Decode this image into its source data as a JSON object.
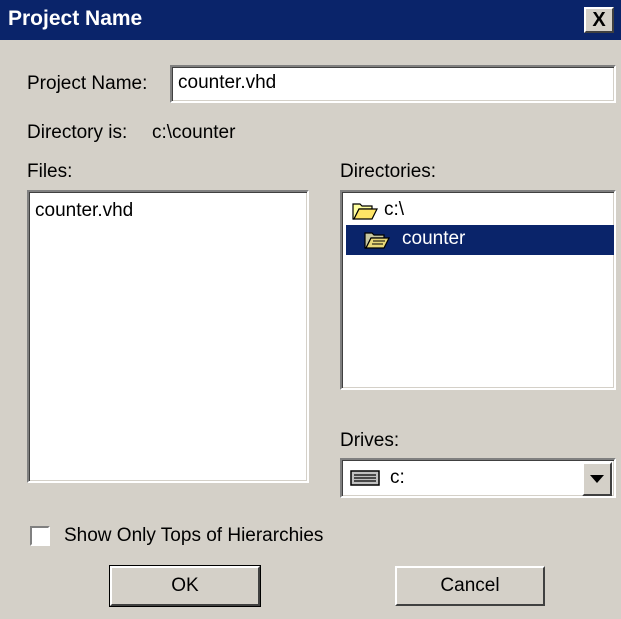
{
  "window": {
    "title": "Project Name",
    "close_label": "X"
  },
  "project_name": {
    "label": "Project Name:",
    "value": "counter.vhd"
  },
  "directory": {
    "label": "Directory is:",
    "path": "c:\\counter"
  },
  "files": {
    "label": "Files:",
    "items": [
      "counter.vhd"
    ]
  },
  "directories": {
    "label": "Directories:",
    "items": [
      {
        "label": "c:\\",
        "icon": "open-folder-icon",
        "selected": false
      },
      {
        "label": "counter",
        "icon": "open-folder-icon",
        "selected": true
      }
    ]
  },
  "drives": {
    "label": "Drives:",
    "value": "c:",
    "icon": "drive-icon"
  },
  "option": {
    "label": "Show Only Tops of Hierarchies",
    "checked": false
  },
  "buttons": {
    "ok": "OK",
    "cancel": "Cancel"
  },
  "colors": {
    "selection": "#0a246a",
    "face": "#d4d0c8"
  }
}
